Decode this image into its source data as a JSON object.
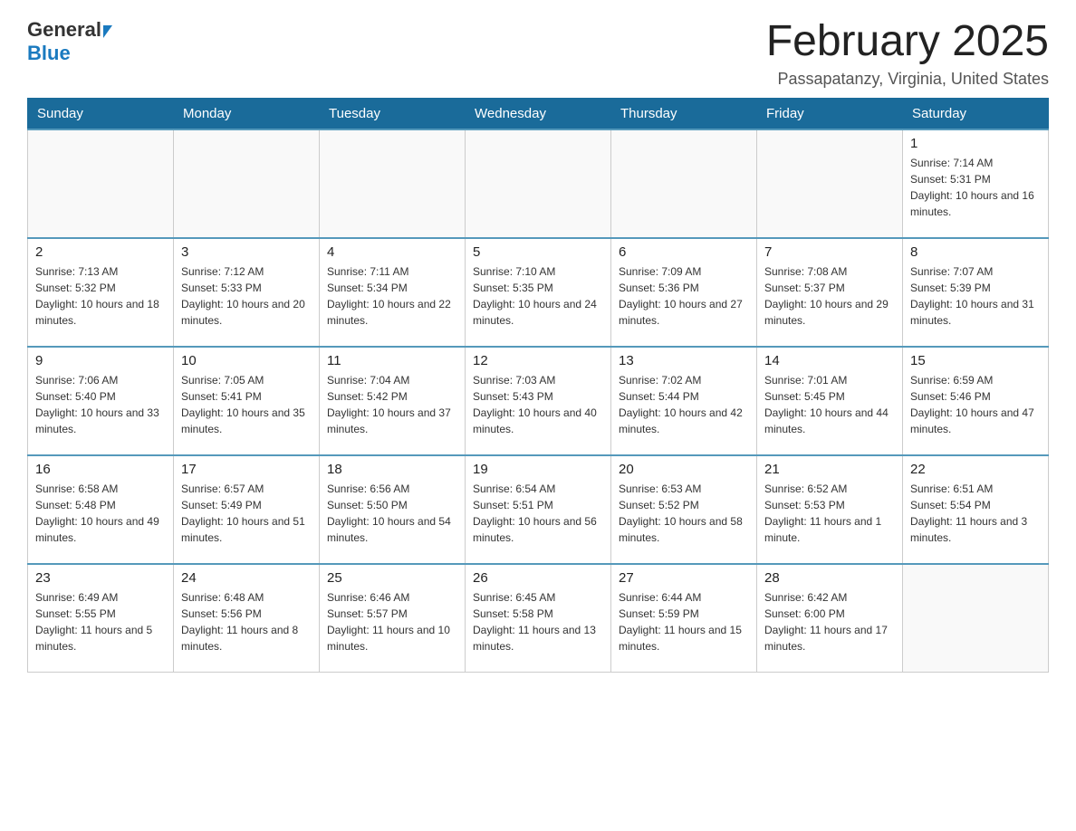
{
  "header": {
    "logo_general": "General",
    "logo_blue": "Blue",
    "month_title": "February 2025",
    "location": "Passapatanzy, Virginia, United States"
  },
  "days_of_week": [
    "Sunday",
    "Monday",
    "Tuesday",
    "Wednesday",
    "Thursday",
    "Friday",
    "Saturday"
  ],
  "weeks": [
    [
      {
        "day": "",
        "info": ""
      },
      {
        "day": "",
        "info": ""
      },
      {
        "day": "",
        "info": ""
      },
      {
        "day": "",
        "info": ""
      },
      {
        "day": "",
        "info": ""
      },
      {
        "day": "",
        "info": ""
      },
      {
        "day": "1",
        "info": "Sunrise: 7:14 AM\nSunset: 5:31 PM\nDaylight: 10 hours and 16 minutes."
      }
    ],
    [
      {
        "day": "2",
        "info": "Sunrise: 7:13 AM\nSunset: 5:32 PM\nDaylight: 10 hours and 18 minutes."
      },
      {
        "day": "3",
        "info": "Sunrise: 7:12 AM\nSunset: 5:33 PM\nDaylight: 10 hours and 20 minutes."
      },
      {
        "day": "4",
        "info": "Sunrise: 7:11 AM\nSunset: 5:34 PM\nDaylight: 10 hours and 22 minutes."
      },
      {
        "day": "5",
        "info": "Sunrise: 7:10 AM\nSunset: 5:35 PM\nDaylight: 10 hours and 24 minutes."
      },
      {
        "day": "6",
        "info": "Sunrise: 7:09 AM\nSunset: 5:36 PM\nDaylight: 10 hours and 27 minutes."
      },
      {
        "day": "7",
        "info": "Sunrise: 7:08 AM\nSunset: 5:37 PM\nDaylight: 10 hours and 29 minutes."
      },
      {
        "day": "8",
        "info": "Sunrise: 7:07 AM\nSunset: 5:39 PM\nDaylight: 10 hours and 31 minutes."
      }
    ],
    [
      {
        "day": "9",
        "info": "Sunrise: 7:06 AM\nSunset: 5:40 PM\nDaylight: 10 hours and 33 minutes."
      },
      {
        "day": "10",
        "info": "Sunrise: 7:05 AM\nSunset: 5:41 PM\nDaylight: 10 hours and 35 minutes."
      },
      {
        "day": "11",
        "info": "Sunrise: 7:04 AM\nSunset: 5:42 PM\nDaylight: 10 hours and 37 minutes."
      },
      {
        "day": "12",
        "info": "Sunrise: 7:03 AM\nSunset: 5:43 PM\nDaylight: 10 hours and 40 minutes."
      },
      {
        "day": "13",
        "info": "Sunrise: 7:02 AM\nSunset: 5:44 PM\nDaylight: 10 hours and 42 minutes."
      },
      {
        "day": "14",
        "info": "Sunrise: 7:01 AM\nSunset: 5:45 PM\nDaylight: 10 hours and 44 minutes."
      },
      {
        "day": "15",
        "info": "Sunrise: 6:59 AM\nSunset: 5:46 PM\nDaylight: 10 hours and 47 minutes."
      }
    ],
    [
      {
        "day": "16",
        "info": "Sunrise: 6:58 AM\nSunset: 5:48 PM\nDaylight: 10 hours and 49 minutes."
      },
      {
        "day": "17",
        "info": "Sunrise: 6:57 AM\nSunset: 5:49 PM\nDaylight: 10 hours and 51 minutes."
      },
      {
        "day": "18",
        "info": "Sunrise: 6:56 AM\nSunset: 5:50 PM\nDaylight: 10 hours and 54 minutes."
      },
      {
        "day": "19",
        "info": "Sunrise: 6:54 AM\nSunset: 5:51 PM\nDaylight: 10 hours and 56 minutes."
      },
      {
        "day": "20",
        "info": "Sunrise: 6:53 AM\nSunset: 5:52 PM\nDaylight: 10 hours and 58 minutes."
      },
      {
        "day": "21",
        "info": "Sunrise: 6:52 AM\nSunset: 5:53 PM\nDaylight: 11 hours and 1 minute."
      },
      {
        "day": "22",
        "info": "Sunrise: 6:51 AM\nSunset: 5:54 PM\nDaylight: 11 hours and 3 minutes."
      }
    ],
    [
      {
        "day": "23",
        "info": "Sunrise: 6:49 AM\nSunset: 5:55 PM\nDaylight: 11 hours and 5 minutes."
      },
      {
        "day": "24",
        "info": "Sunrise: 6:48 AM\nSunset: 5:56 PM\nDaylight: 11 hours and 8 minutes."
      },
      {
        "day": "25",
        "info": "Sunrise: 6:46 AM\nSunset: 5:57 PM\nDaylight: 11 hours and 10 minutes."
      },
      {
        "day": "26",
        "info": "Sunrise: 6:45 AM\nSunset: 5:58 PM\nDaylight: 11 hours and 13 minutes."
      },
      {
        "day": "27",
        "info": "Sunrise: 6:44 AM\nSunset: 5:59 PM\nDaylight: 11 hours and 15 minutes."
      },
      {
        "day": "28",
        "info": "Sunrise: 6:42 AM\nSunset: 6:00 PM\nDaylight: 11 hours and 17 minutes."
      },
      {
        "day": "",
        "info": ""
      }
    ]
  ]
}
